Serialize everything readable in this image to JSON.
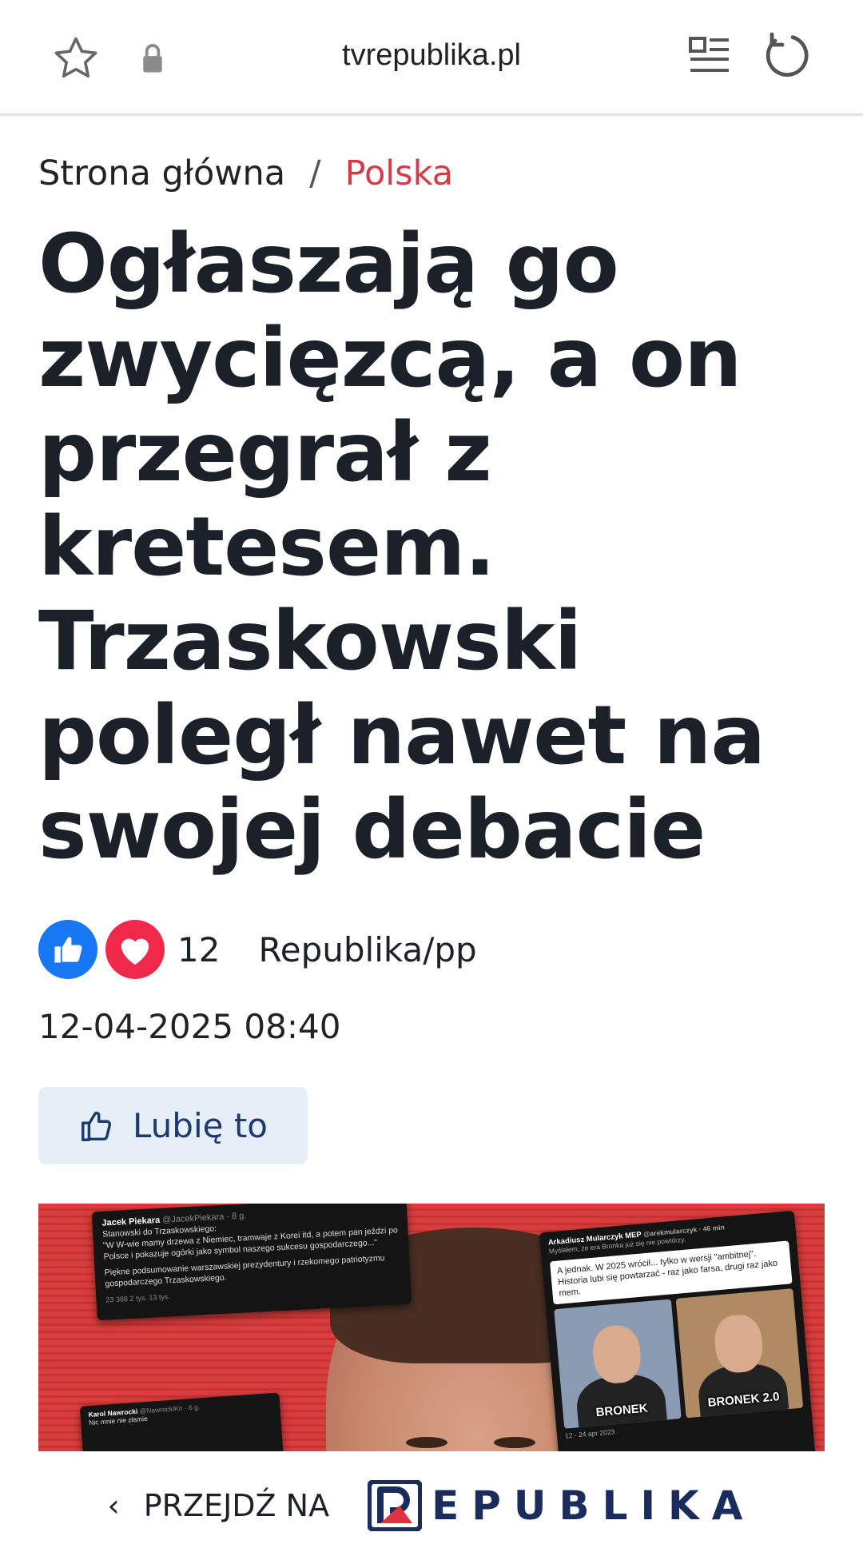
{
  "browser": {
    "url": "tvrepublika.pl",
    "icons": [
      "star-icon",
      "lock-icon",
      "reader-mode-icon",
      "reload-icon"
    ]
  },
  "breadcrumb": {
    "home": "Strona główna",
    "separator": "/",
    "current": "Polska"
  },
  "article": {
    "headline": "Ogłaszają go zwycięzcą, a on przegrał z kretesem. Trzaskowski poległ nawet na swojej debacie",
    "reactions_count": "12",
    "source": "Republika/pp",
    "date": "12-04-2025 08:40",
    "like_button_label": "Lubię to"
  },
  "hero_image": {
    "tweet1": {
      "author": "Jacek Piekara",
      "handle": "@JacekPiekara · 8 g.",
      "text1": "Stanowski do Trzaskowskiego:",
      "text2": "\"W W-wie mamy drzewa z Niemiec, tramwaje z Korei itd, a potem pan jeździ po Polsce i pokazuje ogórki jako symbol naszego sukcesu gospodarczego...\"",
      "text3": "Piękne podsumowanie warszawskiej prezydentury i rzekomego patriotyzmu gospodarczego Trzaskowskiego.",
      "stats": "23   388   2 tys.   13 tys."
    },
    "tweet2": {
      "author": "Arkadiusz Mularczyk MEP",
      "handle": "@arekmularczyk · 46 min",
      "sub": "Myślałem, że era Bronka już się nie powtórzy.",
      "quote": "A jednak. W 2025 wrócił... tylko w wersji \"ambitnej\". Historia lubi się powtarzać - raz jako farsa, drugi raz jako mem.",
      "label_left": "BRONEK",
      "label_right": "BRONEK 2.0",
      "date": "12 · 24 apr 2023"
    },
    "tweet3": {
      "author": "Karol Nawrocki",
      "handle": "@NawrockiKn · 6 g.",
      "text": "Nic mnie nie złamie"
    }
  },
  "bottom_bar": {
    "chevron": "‹",
    "goto_label": "PRZEJDŹ NA",
    "brand": "EPUBLIKA"
  },
  "colors": {
    "accent_red": "#d63a4a",
    "brand_navy": "#1a2c5c",
    "like_blue": "#1877f2",
    "heart_red": "#f0284a",
    "button_bg": "#e6eef8"
  }
}
